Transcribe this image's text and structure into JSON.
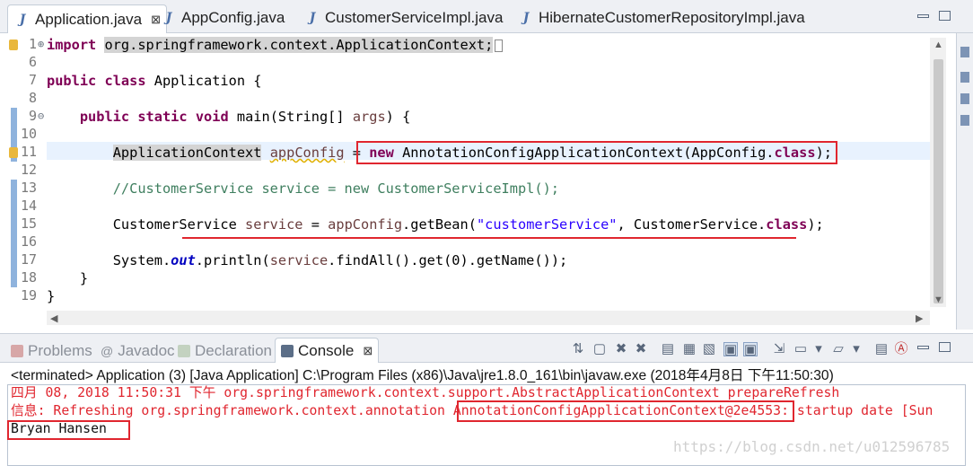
{
  "editor": {
    "tabs": [
      {
        "label": "Application.java",
        "close": "⊠",
        "active": true
      },
      {
        "label": "AppConfig.java"
      },
      {
        "label": "CustomerServiceImpl.java"
      },
      {
        "label": "HibernateCustomerRepositoryImpl.java"
      }
    ],
    "line_numbers": [
      "1",
      "6",
      "7",
      "8",
      "9",
      "10",
      "11",
      "12",
      "13",
      "14",
      "15",
      "16",
      "17",
      "18",
      "19"
    ],
    "fold_markers": {
      "line1": "⊕",
      "line9": "⊖"
    },
    "code": {
      "l1_kw": "import",
      "l1_pkg": "org.springframework.context.ApplicationContext",
      "l1_end": ";",
      "l7_kw1": "public",
      "l7_kw2": "class",
      "l7_name": " Application {",
      "l9_kw1": "public",
      "l9_kw2": "static",
      "l9_kw3": "void",
      "l9_sig": " main(String[] ",
      "l9_var": "args",
      "l9_end": ") {",
      "l11_type": "ApplicationContext",
      "l11_var": "appConfig",
      "l11_eq": " = ",
      "l11_new": "new",
      "l11_ctor": " AnnotationConfigApplicationContext(AppConfig.",
      "l11_class": "class",
      "l11_end": ");",
      "l13_comment": "//CustomerService service = new CustomerServiceImpl();",
      "l15_type": "CustomerService ",
      "l15_var": "service",
      "l15_eq": " = ",
      "l15_ref": "appConfig",
      "l15_call": ".getBean(",
      "l15_str": "\"customerService\"",
      "l15_mid": ", CustomerService.",
      "l15_class": "class",
      "l15_end": ");",
      "l17_a": "System.",
      "l17_field": "out",
      "l17_b": ".println(",
      "l17_var": "service",
      "l17_c": ".findAll().get(0).getName());",
      "l18": "}",
      "l19": "}"
    }
  },
  "console": {
    "tabs": [
      {
        "label": "Problems"
      },
      {
        "label": "Javadoc"
      },
      {
        "label": "Declaration"
      },
      {
        "label": "Console",
        "close": "⊠",
        "active": true
      }
    ],
    "status": "<terminated> Application (3) [Java Application] C:\\Program Files (x86)\\Java\\jre1.8.0_161\\bin\\javaw.exe (2018年4月8日 下午11:50:30)",
    "lines": {
      "err1": "四月 08, 2018 11:50:31 下午 org.springframework.context.support.AbstractApplicationContext prepareRefresh",
      "err2_a": "信息: Refreshing org.springframework.context.annotation ",
      "err2_b": "AnnotationConfigApplicationContext@2e4553",
      "err2_c": ": startup date [Sun",
      "out1": "Bryan Hansen"
    },
    "watermark": "https://blog.csdn.net/u012596785"
  },
  "colors": {
    "keyword": "#7f0055",
    "string": "#2a00ff",
    "comment": "#3f7f5f",
    "annotation_red": "#e0262f"
  }
}
